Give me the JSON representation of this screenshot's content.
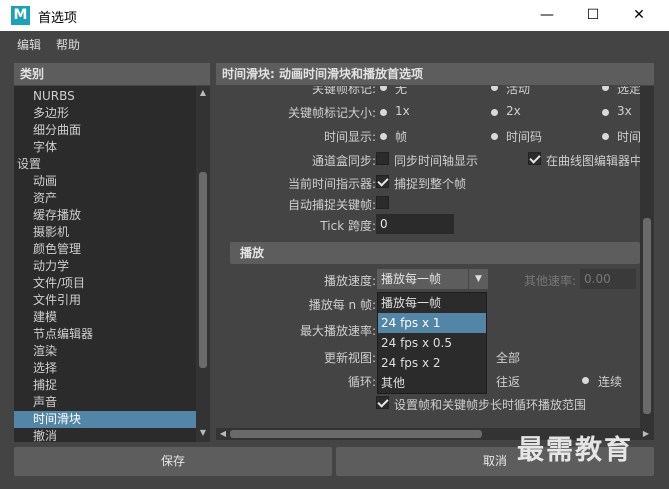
{
  "window": {
    "title": "首选项",
    "app_logo": "M"
  },
  "controls": {
    "minimize": "—",
    "maximize": "☐",
    "close": "✕"
  },
  "menu": {
    "edit": "编辑",
    "help": "帮助"
  },
  "categories": {
    "header": "类别",
    "items": [
      {
        "label": "NURBS",
        "indent": 1
      },
      {
        "label": "多边形",
        "indent": 1
      },
      {
        "label": "细分曲面",
        "indent": 1
      },
      {
        "label": "字体",
        "indent": 1
      },
      {
        "label": "设置",
        "indent": 0
      },
      {
        "label": "动画",
        "indent": 1
      },
      {
        "label": "资产",
        "indent": 1
      },
      {
        "label": "缓存播放",
        "indent": 1
      },
      {
        "label": "摄影机",
        "indent": 1
      },
      {
        "label": "颜色管理",
        "indent": 1
      },
      {
        "label": "动力学",
        "indent": 1
      },
      {
        "label": "文件/项目",
        "indent": 1
      },
      {
        "label": "文件引用",
        "indent": 1
      },
      {
        "label": "建模",
        "indent": 1
      },
      {
        "label": "节点编辑器",
        "indent": 1
      },
      {
        "label": "渲染",
        "indent": 1
      },
      {
        "label": "选择",
        "indent": 1
      },
      {
        "label": "捕捉",
        "indent": 1
      },
      {
        "label": "声音",
        "indent": 1
      },
      {
        "label": "时间滑块",
        "indent": 1,
        "selected": true
      },
      {
        "label": "撤消",
        "indent": 1
      }
    ]
  },
  "content": {
    "header": "时间滑块: 动画时间滑块和播放首选项",
    "partial_row": {
      "label": "关键帧标记:",
      "opt1": "无",
      "opt2": "活动",
      "opt3": "选定"
    },
    "key_size": {
      "label": "关键帧标记大小:",
      "opt1": "1x",
      "opt2": "2x",
      "opt3": "3x"
    },
    "time_display": {
      "label": "时间显示:",
      "opt1": "帧",
      "opt2": "时间码",
      "opt3": "时间"
    },
    "channel_sync": {
      "label": "通道盒同步:",
      "opt1": "同步时间轴显示",
      "opt2": "在曲线图编辑器中"
    },
    "current_indicator": {
      "label": "当前时间指示器:",
      "opt1": "捕捉到整个帧"
    },
    "auto_snap": {
      "label": "自动捕捉关键帧:"
    },
    "tick_span": {
      "label": "Tick 跨度:",
      "value": "0"
    },
    "playback": {
      "section": "播放",
      "speed_label": "播放速度:",
      "speed_value": "播放每一帧",
      "other_speed_label": "其他速率:",
      "other_speed_value": "0.00",
      "every_n_label": "播放每 n 帧:",
      "max_speed_label": "最大播放速率:",
      "update_view_label": "更新视图:",
      "update_view_opt": "全部",
      "loop_label": "循环:",
      "loop_opt1": "往返",
      "loop_opt2": "连续",
      "set_range_label": "设置帧和关键帧步长时循环播放范围"
    },
    "dropdown": [
      "播放每一帧",
      "24 fps x 1",
      "24 fps x 0.5",
      "24 fps x 2",
      "其他"
    ]
  },
  "buttons": {
    "save": "保存",
    "cancel": "取消"
  },
  "watermark": "最需教育"
}
